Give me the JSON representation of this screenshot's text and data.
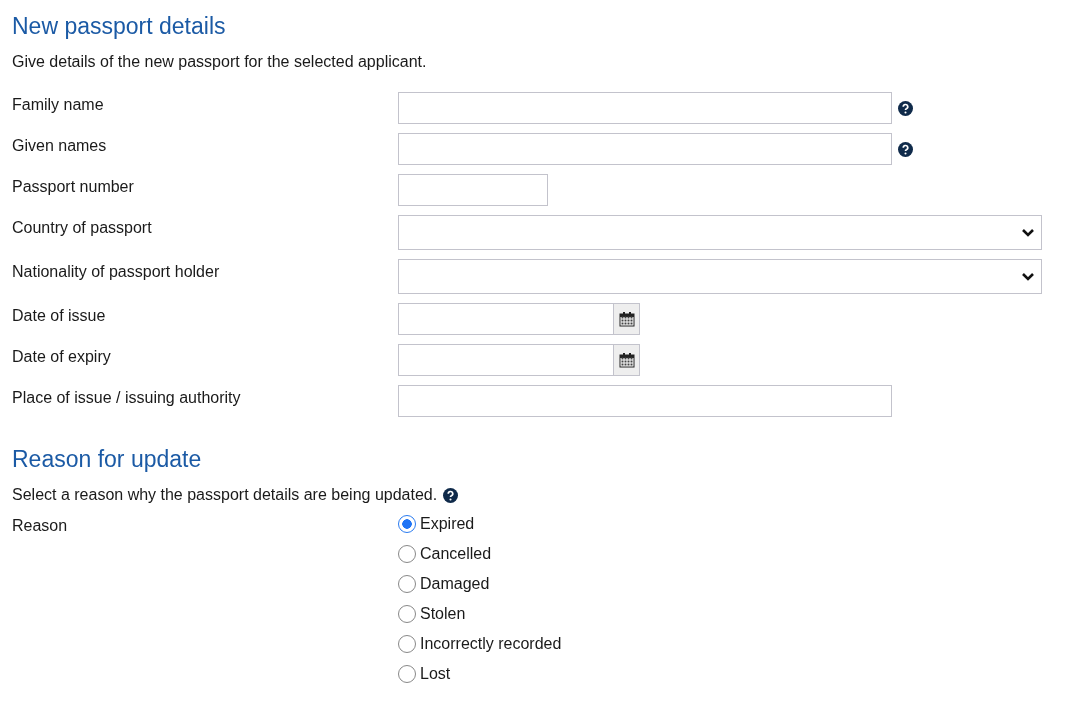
{
  "passport_section": {
    "heading": "New passport details",
    "intro": "Give details of the new passport for the selected applicant.",
    "fields": [
      {
        "label": "Family name",
        "kind": "text",
        "help": true
      },
      {
        "label": "Given names",
        "kind": "text",
        "help": true
      },
      {
        "label": "Passport number",
        "kind": "number",
        "help": false
      },
      {
        "label": "Country of passport",
        "kind": "select",
        "help": false
      },
      {
        "label": "Nationality of passport holder",
        "kind": "select",
        "help": false
      },
      {
        "label": "Date of issue",
        "kind": "date",
        "help": false
      },
      {
        "label": "Date of expiry",
        "kind": "date",
        "help": false
      },
      {
        "label": "Place of issue / issuing authority",
        "kind": "text",
        "help": false
      }
    ]
  },
  "reason_section": {
    "heading": "Reason for update",
    "intro": "Select a reason why the passport details are being updated.",
    "intro_help": true,
    "label": "Reason",
    "options": [
      {
        "label": "Expired",
        "selected": true
      },
      {
        "label": "Cancelled",
        "selected": false
      },
      {
        "label": "Damaged",
        "selected": false
      },
      {
        "label": "Stolen",
        "selected": false
      },
      {
        "label": "Incorrectly recorded",
        "selected": false
      },
      {
        "label": "Lost",
        "selected": false
      }
    ]
  }
}
